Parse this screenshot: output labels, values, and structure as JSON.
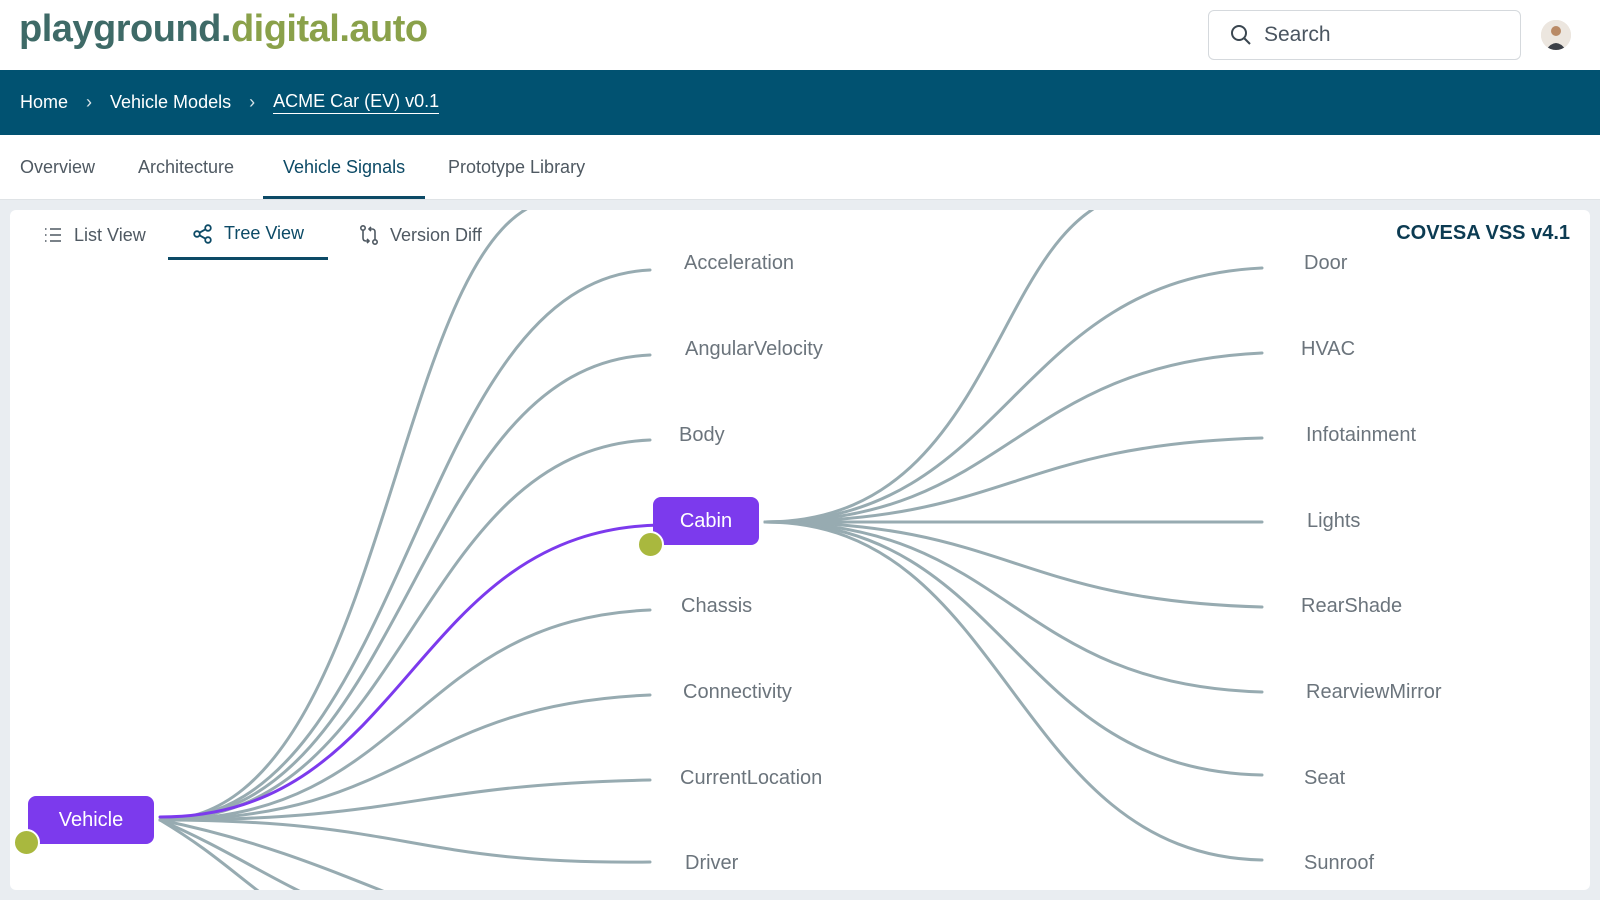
{
  "app": {
    "logo_part1": "playground.",
    "logo_part2": "digital.auto",
    "search_placeholder": "Search"
  },
  "breadcrumb": [
    "Home",
    "Vehicle Models",
    "ACME Car (EV) v0.1"
  ],
  "tabs": [
    "Overview",
    "Architecture",
    "Vehicle Signals",
    "Prototype Library"
  ],
  "active_tab": "Vehicle Signals",
  "view_tabs": [
    "List View",
    "Tree View",
    "Version Diff"
  ],
  "active_view": "Tree View",
  "version_label": "COVESA VSS v4.1",
  "tree": {
    "root": "Vehicle",
    "selected": "Cabin",
    "level1": [
      "Acceleration",
      "AngularVelocity",
      "Body",
      "Cabin",
      "Chassis",
      "Connectivity",
      "CurrentLocation",
      "Driver"
    ],
    "cabin_children": [
      "Door",
      "HVAC",
      "Infotainment",
      "Lights",
      "RearShade",
      "RearviewMirror",
      "Seat",
      "Sunroof"
    ]
  },
  "colors": {
    "header_bar": "#015271",
    "node_purple": "#7c3aed",
    "toggle_dot": "#a9b83e",
    "link_grey": "#97abb1"
  },
  "icons": {
    "search": "search-icon",
    "list_view": "list-icon",
    "tree_view": "share-tree-icon",
    "version_diff": "git-compare-icon"
  }
}
